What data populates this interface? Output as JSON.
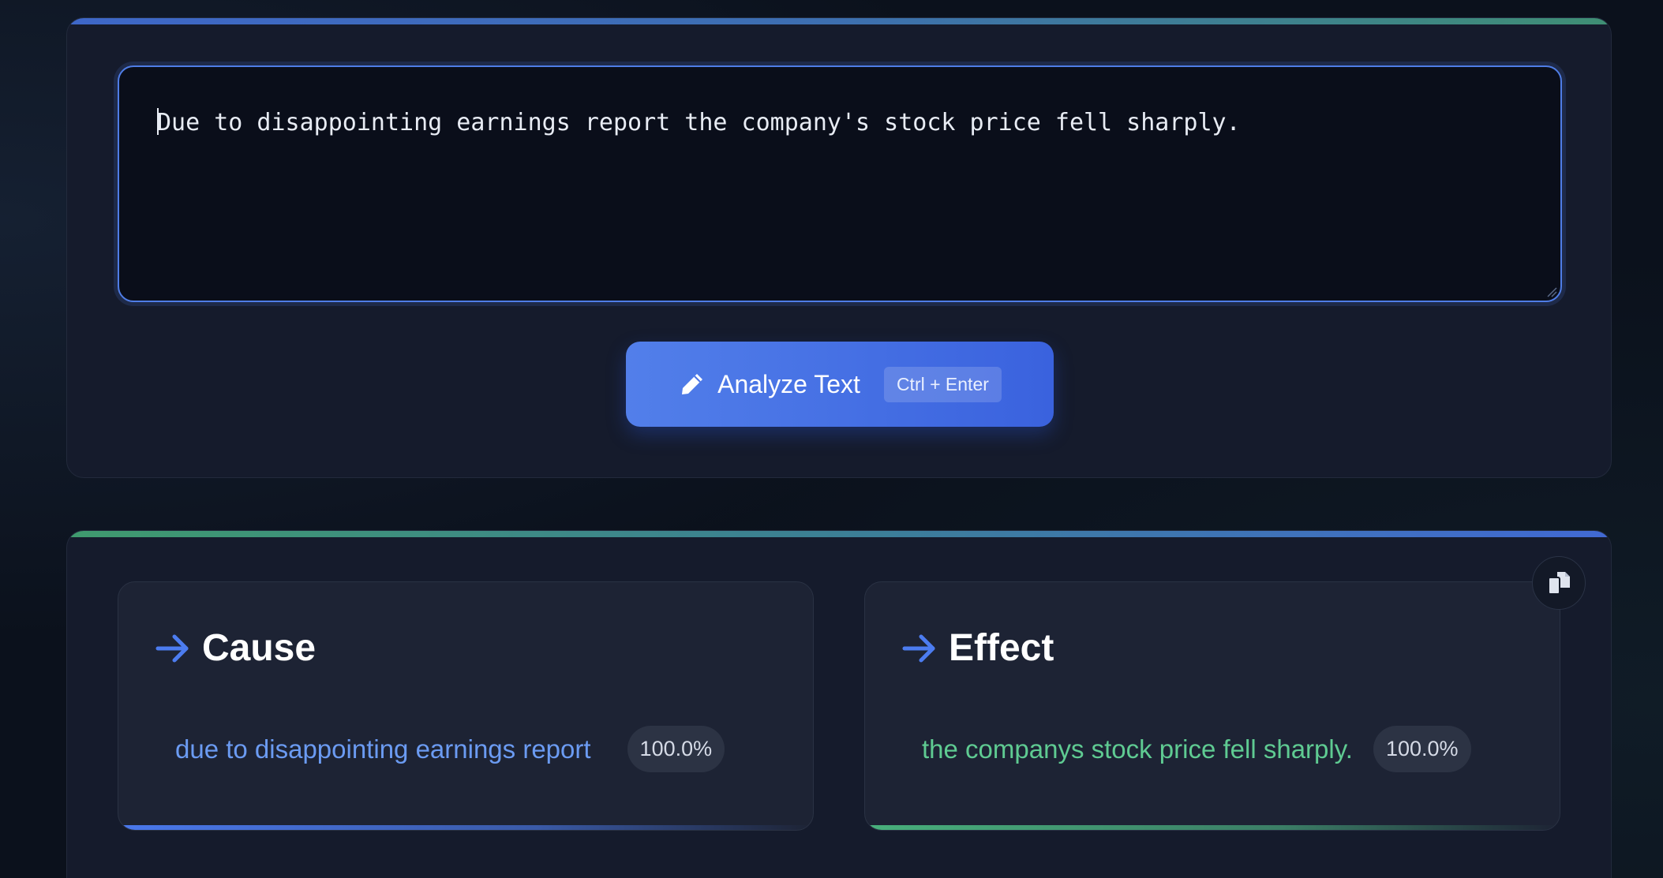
{
  "input": {
    "text": "Due to disappointing earnings report the company's stock price fell sharply."
  },
  "analyze_button": {
    "label": "Analyze Text",
    "shortcut": "Ctrl + Enter",
    "icon": "pen-icon"
  },
  "results": {
    "copy_icon": "copy-icon",
    "cause": {
      "title": "Cause",
      "icon": "arrow-right-icon",
      "phrase": "due to disappointing earnings report",
      "score": "100.0%",
      "color": "#6b9bf2"
    },
    "effect": {
      "title": "Effect",
      "icon": "arrow-right-icon",
      "phrase": "the companys stock price fell sharply.",
      "score": "100.0%",
      "color": "#5fcb92"
    }
  },
  "colors": {
    "accent_blue": "#4f7de6",
    "accent_green": "#48b07c",
    "background": "#0b111c",
    "card": "#151b2c"
  }
}
